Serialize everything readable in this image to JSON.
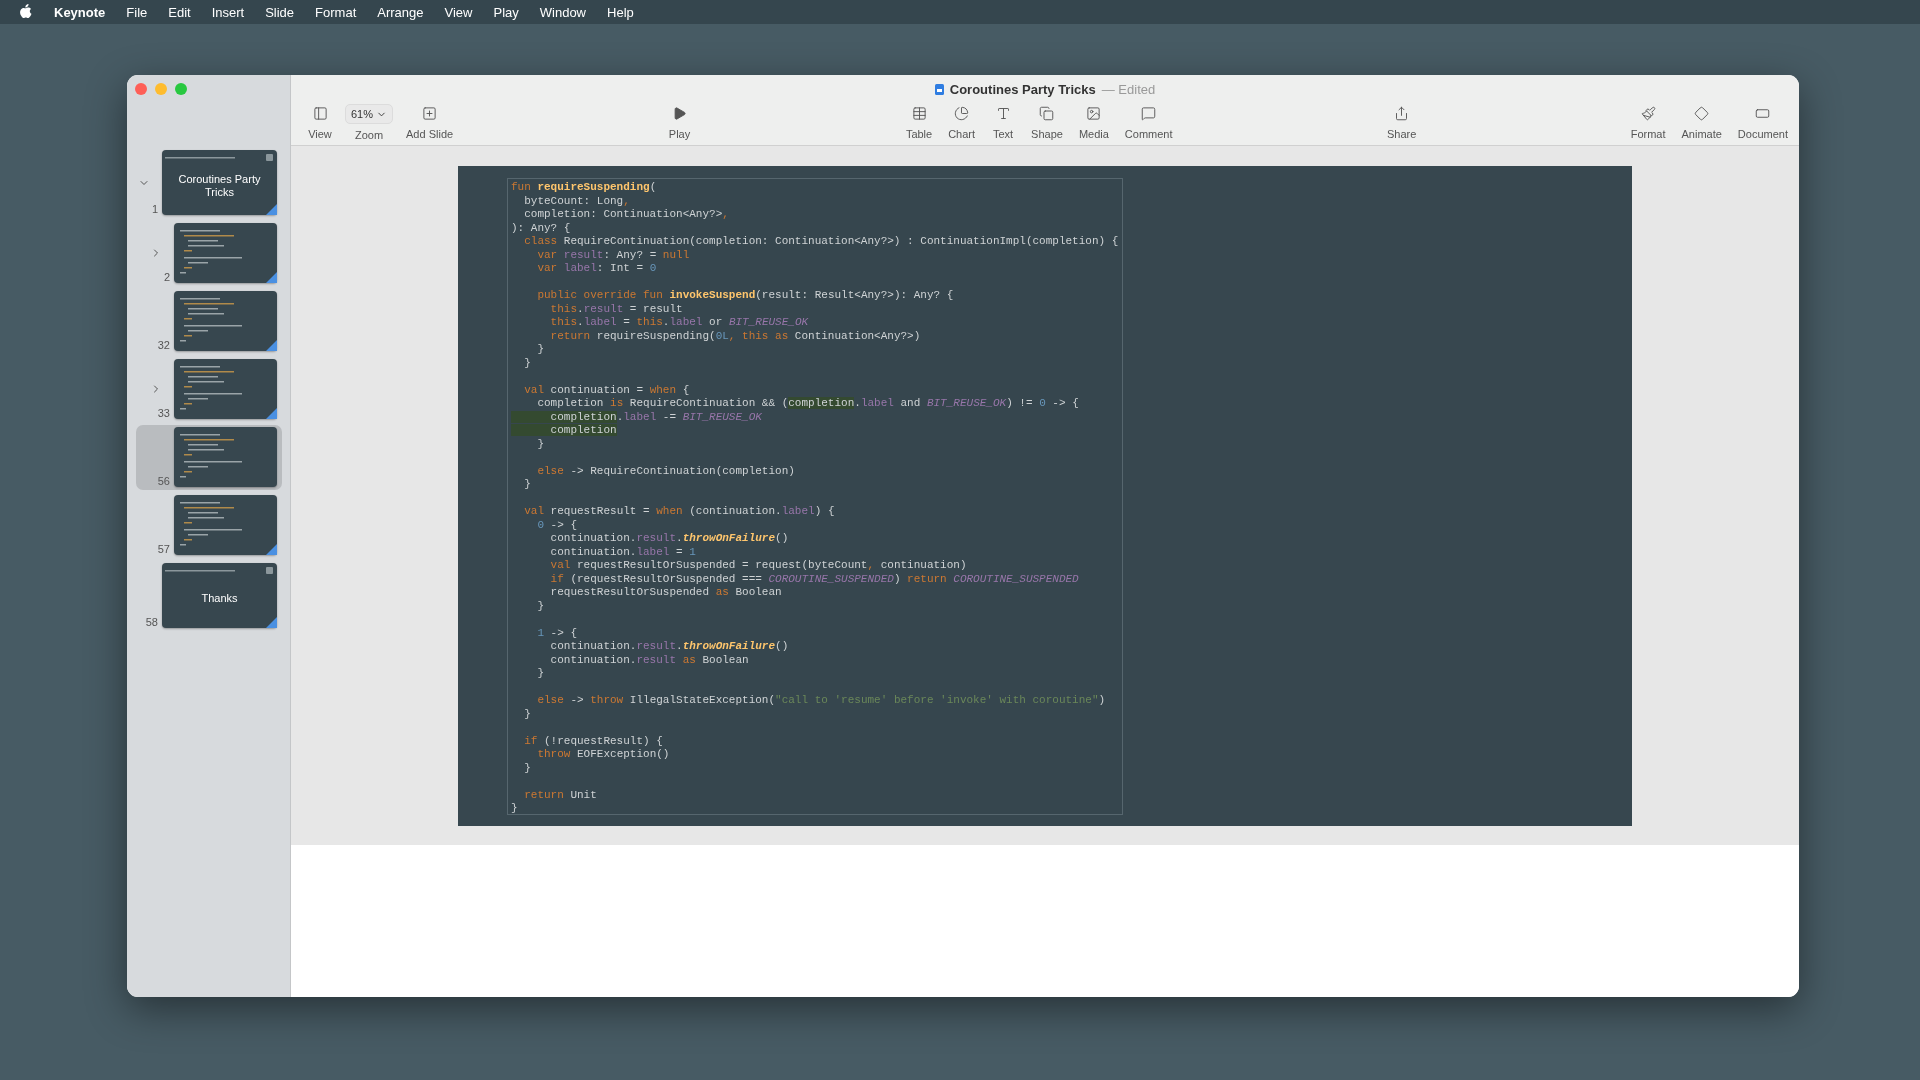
{
  "menu_bar": {
    "app_name": "Keynote",
    "items": [
      "File",
      "Edit",
      "Insert",
      "Slide",
      "Format",
      "Arrange",
      "View",
      "Play",
      "Window",
      "Help"
    ]
  },
  "window": {
    "title": "Coroutines Party Tricks",
    "status": "— Edited"
  },
  "toolbar": {
    "groups": [
      [
        {
          "kind": "button",
          "label": "View"
        },
        {
          "kind": "dropdown",
          "label": "Zoom",
          "value": "61%"
        },
        {
          "kind": "button",
          "label": "Add Slide"
        }
      ],
      [
        {
          "kind": "button",
          "label": "Play"
        }
      ],
      [
        {
          "kind": "button",
          "label": "Table"
        },
        {
          "kind": "button",
          "label": "Chart"
        },
        {
          "kind": "button",
          "label": "Text"
        },
        {
          "kind": "button",
          "label": "Shape"
        },
        {
          "kind": "button",
          "label": "Media"
        },
        {
          "kind": "button",
          "label": "Comment"
        }
      ],
      [
        {
          "kind": "button",
          "label": "Share"
        }
      ],
      [
        {
          "kind": "button",
          "label": "Format"
        },
        {
          "kind": "button",
          "label": "Animate"
        },
        {
          "kind": "button",
          "label": "Document"
        }
      ]
    ]
  },
  "slides": [
    {
      "number": "1",
      "kind": "title",
      "title": "Coroutines Party Tricks",
      "selected": false,
      "expanded": true,
      "transition": true,
      "children": [
        {
          "number": "2",
          "kind": "code",
          "selected": false,
          "expanded": false,
          "transition": true
        },
        {
          "number": "32",
          "kind": "code",
          "selected": false,
          "transition": true
        },
        {
          "number": "33",
          "kind": "code",
          "selected": false,
          "expanded": false,
          "transition": true
        },
        {
          "number": "56",
          "kind": "code",
          "selected": true,
          "transition": false
        },
        {
          "number": "57",
          "kind": "code",
          "selected": false,
          "transition": true
        }
      ]
    },
    {
      "number": "58",
      "kind": "title",
      "title": "Thanks",
      "selected": false,
      "transition": true
    }
  ],
  "code": [
    {
      "tokens": [
        {
          "text": "fun ",
          "kind": "keyword"
        },
        {
          "text": "requireSuspending",
          "kind": "function"
        },
        {
          "text": "(",
          "kind": "plain"
        }
      ]
    },
    {
      "tokens": [
        {
          "text": "  byteCount: Long",
          "kind": "plain"
        },
        {
          "text": ",",
          "kind": "keyword"
        }
      ]
    },
    {
      "tokens": [
        {
          "text": "  completion: Continuation<Any?>",
          "kind": "plain"
        },
        {
          "text": ",",
          "kind": "keyword"
        }
      ]
    },
    {
      "tokens": [
        {
          "text": "): Any? {",
          "kind": "plain"
        }
      ]
    },
    {
      "tokens": [
        {
          "text": "  class",
          "kind": "keyword"
        },
        {
          "text": " RequireContinuation(completion: Continuation<Any?>) : ContinuationImpl(completion) {",
          "kind": "plain"
        }
      ]
    },
    {
      "tokens": [
        {
          "text": "    var ",
          "kind": "keyword"
        },
        {
          "text": "result",
          "kind": "property"
        },
        {
          "text": ": Any? = ",
          "kind": "plain"
        },
        {
          "text": "null",
          "kind": "keyword"
        }
      ]
    },
    {
      "tokens": [
        {
          "text": "    var ",
          "kind": "keyword"
        },
        {
          "text": "label",
          "kind": "property"
        },
        {
          "text": ": Int = ",
          "kind": "plain"
        },
        {
          "text": "0",
          "kind": "number"
        }
      ]
    },
    {
      "gap_before": true,
      "tokens": [
        {
          "text": "    public override fun ",
          "kind": "keyword"
        },
        {
          "text": "invokeSuspend",
          "kind": "function"
        },
        {
          "text": "(result: Result<Any?>): Any? {",
          "kind": "plain"
        }
      ]
    },
    {
      "tokens": [
        {
          "text": "      this",
          "kind": "keyword"
        },
        {
          "text": ".",
          "kind": "plain"
        },
        {
          "text": "result",
          "kind": "property"
        },
        {
          "text": " = result",
          "kind": "plain"
        }
      ]
    },
    {
      "tokens": [
        {
          "text": "      this",
          "kind": "keyword"
        },
        {
          "text": ".",
          "kind": "plain"
        },
        {
          "text": "label",
          "kind": "property"
        },
        {
          "text": " = ",
          "kind": "plain"
        },
        {
          "text": "this",
          "kind": "keyword"
        },
        {
          "text": ".",
          "kind": "plain"
        },
        {
          "text": "label",
          "kind": "property"
        },
        {
          "text": " or ",
          "kind": "plain"
        },
        {
          "text": "BIT_REUSE_OK",
          "kind": "constant"
        }
      ]
    },
    {
      "tokens": [
        {
          "text": "      return",
          "kind": "keyword"
        },
        {
          "text": " requireSuspending(",
          "kind": "plain"
        },
        {
          "text": "0L",
          "kind": "number"
        },
        {
          "text": ", this as",
          "kind": "keyword"
        },
        {
          "text": " Continuation<Any?>)",
          "kind": "plain"
        }
      ]
    },
    {
      "tokens": [
        {
          "text": "    }",
          "kind": "plain"
        }
      ]
    },
    {
      "tokens": [
        {
          "text": "  }",
          "kind": "plain"
        }
      ]
    },
    {
      "gap_before": true,
      "tokens": [
        {
          "text": "  val",
          "kind": "keyword"
        },
        {
          "text": " continuation = ",
          "kind": "plain"
        },
        {
          "text": "when",
          "kind": "keyword"
        },
        {
          "text": " {",
          "kind": "plain"
        }
      ]
    },
    {
      "tokens": [
        {
          "text": "    completion ",
          "kind": "plain"
        },
        {
          "text": "is",
          "kind": "keyword"
        },
        {
          "text": " RequireContinuation && (",
          "kind": "plain"
        },
        {
          "text": "completion",
          "kind": "highlight"
        },
        {
          "text": ".",
          "kind": "plain"
        },
        {
          "text": "label",
          "kind": "property"
        },
        {
          "text": " and ",
          "kind": "plain"
        },
        {
          "text": "BIT_REUSE_OK",
          "kind": "constant"
        },
        {
          "text": ") != ",
          "kind": "plain"
        },
        {
          "text": "0",
          "kind": "number"
        },
        {
          "text": " -> {",
          "kind": "plain"
        }
      ]
    },
    {
      "tokens": [
        {
          "text": "      completion",
          "kind": "highlight"
        },
        {
          "text": ".",
          "kind": "plain"
        },
        {
          "text": "label",
          "kind": "property"
        },
        {
          "text": " -= ",
          "kind": "plain"
        },
        {
          "text": "BIT_REUSE_OK",
          "kind": "constant"
        }
      ]
    },
    {
      "tokens": [
        {
          "text": "      completion",
          "kind": "highlight"
        }
      ]
    },
    {
      "tokens": [
        {
          "text": "    }",
          "kind": "plain"
        }
      ]
    },
    {
      "gap_before": true,
      "tokens": [
        {
          "text": "    else",
          "kind": "keyword"
        },
        {
          "text": " -> RequireContinuation(completion)",
          "kind": "plain"
        }
      ]
    },
    {
      "tokens": [
        {
          "text": "  }",
          "kind": "plain"
        }
      ]
    },
    {
      "gap_before": true,
      "tokens": [
        {
          "text": "  val",
          "kind": "keyword"
        },
        {
          "text": " requestResult = ",
          "kind": "plain"
        },
        {
          "text": "when",
          "kind": "keyword"
        },
        {
          "text": " (continuation.",
          "kind": "plain"
        },
        {
          "text": "label",
          "kind": "property"
        },
        {
          "text": ") {",
          "kind": "plain"
        }
      ]
    },
    {
      "tokens": [
        {
          "text": "    0",
          "kind": "number"
        },
        {
          "text": " -> {",
          "kind": "plain"
        }
      ]
    },
    {
      "tokens": [
        {
          "text": "      continuation.",
          "kind": "plain"
        },
        {
          "text": "result",
          "kind": "property"
        },
        {
          "text": ".",
          "kind": "plain"
        },
        {
          "text": "throwOnFailure",
          "kind": "call"
        },
        {
          "text": "()",
          "kind": "plain"
        }
      ]
    },
    {
      "tokens": [
        {
          "text": "      continuation.",
          "kind": "plain"
        },
        {
          "text": "label",
          "kind": "property"
        },
        {
          "text": " = ",
          "kind": "plain"
        },
        {
          "text": "1",
          "kind": "number"
        }
      ]
    },
    {
      "tokens": [
        {
          "text": "      val",
          "kind": "keyword"
        },
        {
          "text": " requestResultOrSuspended = request(byteCount",
          "kind": "plain"
        },
        {
          "text": ", ",
          "kind": "keyword"
        },
        {
          "text": "continuation)",
          "kind": "plain"
        }
      ]
    },
    {
      "tokens": [
        {
          "text": "      if",
          "kind": "keyword"
        },
        {
          "text": " (requestResultOrSuspended === ",
          "kind": "plain"
        },
        {
          "text": "COROUTINE_SUSPENDED",
          "kind": "constant"
        },
        {
          "text": ") ",
          "kind": "plain"
        },
        {
          "text": "return ",
          "kind": "keyword"
        },
        {
          "text": "COROUTINE_SUSPENDED",
          "kind": "constant"
        }
      ]
    },
    {
      "tokens": [
        {
          "text": "      requestResultOrSuspended ",
          "kind": "plain"
        },
        {
          "text": "as",
          "kind": "keyword"
        },
        {
          "text": " Boolean",
          "kind": "plain"
        }
      ]
    },
    {
      "tokens": [
        {
          "text": "    }",
          "kind": "plain"
        }
      ]
    },
    {
      "gap_before": true,
      "tokens": [
        {
          "text": "    1",
          "kind": "number"
        },
        {
          "text": " -> {",
          "kind": "plain"
        }
      ]
    },
    {
      "tokens": [
        {
          "text": "      continuation.",
          "kind": "plain"
        },
        {
          "text": "result",
          "kind": "property"
        },
        {
          "text": ".",
          "kind": "plain"
        },
        {
          "text": "throwOnFailure",
          "kind": "call"
        },
        {
          "text": "()",
          "kind": "plain"
        }
      ]
    },
    {
      "tokens": [
        {
          "text": "      continuation.",
          "kind": "plain"
        },
        {
          "text": "result",
          "kind": "property"
        },
        {
          "text": " as",
          "kind": "keyword"
        },
        {
          "text": " Boolean",
          "kind": "plain"
        }
      ]
    },
    {
      "tokens": [
        {
          "text": "    }",
          "kind": "plain"
        }
      ]
    },
    {
      "gap_before": true,
      "tokens": [
        {
          "text": "    else",
          "kind": "keyword"
        },
        {
          "text": " -> ",
          "kind": "plain"
        },
        {
          "text": "throw",
          "kind": "keyword"
        },
        {
          "text": " IllegalStateException(",
          "kind": "plain"
        },
        {
          "text": "\"call to 'resume' before 'invoke' with coroutine\"",
          "kind": "string"
        },
        {
          "text": ")",
          "kind": "plain"
        }
      ]
    },
    {
      "tokens": [
        {
          "text": "  }",
          "kind": "plain"
        }
      ]
    },
    {
      "gap_before": true,
      "tokens": [
        {
          "text": "  if",
          "kind": "keyword"
        },
        {
          "text": " (!requestResult) {",
          "kind": "plain"
        }
      ]
    },
    {
      "tokens": [
        {
          "text": "    throw",
          "kind": "keyword"
        },
        {
          "text": " EOFException()",
          "kind": "plain"
        }
      ]
    },
    {
      "tokens": [
        {
          "text": "  }",
          "kind": "plain"
        }
      ]
    },
    {
      "gap_before": true,
      "tokens": [
        {
          "text": "  return",
          "kind": "keyword"
        },
        {
          "text": " Unit",
          "kind": "plain"
        }
      ]
    },
    {
      "tokens": [
        {
          "text": "}",
          "kind": "plain"
        }
      ]
    }
  ]
}
